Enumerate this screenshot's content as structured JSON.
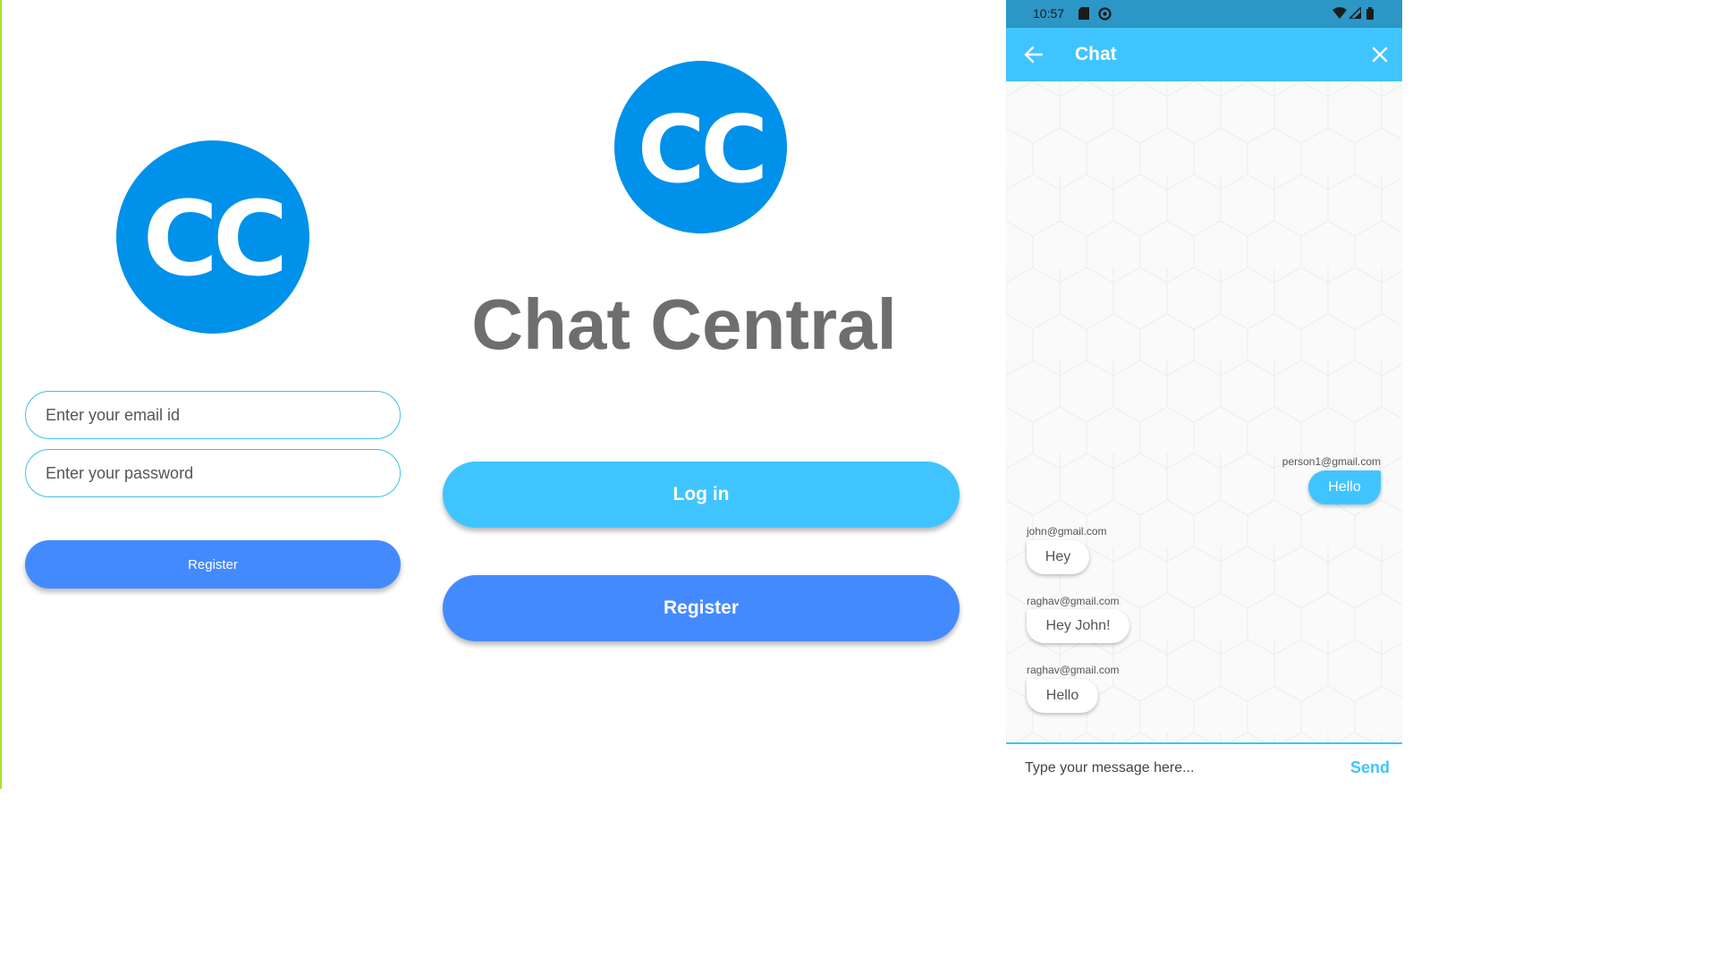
{
  "colors": {
    "logo_blue": "#0091ea",
    "accent_light_blue": "#40c4ff",
    "accent_blue": "#448aff",
    "title_gray": "#6e6e6e",
    "status_bar": "#2c97c6"
  },
  "register_screen": {
    "logo_text": "CC",
    "email_placeholder": "Enter your email id",
    "password_placeholder": "Enter your password",
    "register_label": "Register"
  },
  "welcome_screen": {
    "logo_text": "CC",
    "title": "Chat Central",
    "login_label": "Log in",
    "register_label": "Register"
  },
  "chat_screen": {
    "status_bar": {
      "time": "10:57",
      "icons": [
        "sim-card-icon",
        "at-sign-icon",
        "wifi-icon",
        "signal-icon",
        "battery-icon"
      ]
    },
    "app_bar": {
      "title": "Chat",
      "back_icon": "arrow-back-icon",
      "close_icon": "close-icon"
    },
    "messages": [
      {
        "sender": "person1@gmail.com",
        "text": "Hello",
        "is_me": true
      },
      {
        "sender": "john@gmail.com",
        "text": "Hey",
        "is_me": false
      },
      {
        "sender": "raghav@gmail.com",
        "text": "Hey John!",
        "is_me": false
      },
      {
        "sender": "raghav@gmail.com",
        "text": "Hello",
        "is_me": false
      }
    ],
    "input": {
      "placeholder": "Type your message here...",
      "send_label": "Send"
    }
  }
}
